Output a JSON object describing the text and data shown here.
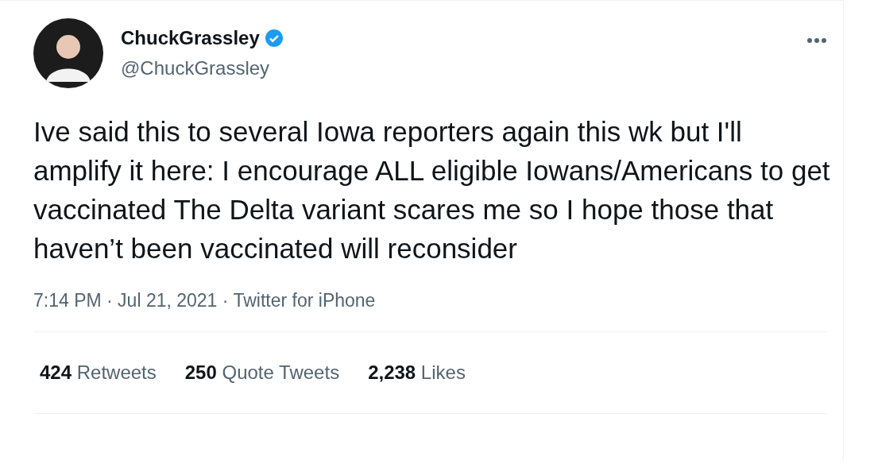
{
  "tweet": {
    "author": {
      "name": "ChuckGrassley",
      "handle": "@ChuckGrassley",
      "verified": true
    },
    "text": "Ive said this to several Iowa reporters again this wk but I'll amplify it here: I encourage ALL eligible Iowans/Americans to get vaccinated The Delta variant scares me so I hope those that haven’t been vaccinated will reconsider",
    "timestamp": "7:14 PM · Jul 21, 2021 · Twitter for iPhone",
    "stats": [
      "**424** Retweets",
      "**250** Quote Tweets",
      "**2,238** Likes"
    ]
  }
}
